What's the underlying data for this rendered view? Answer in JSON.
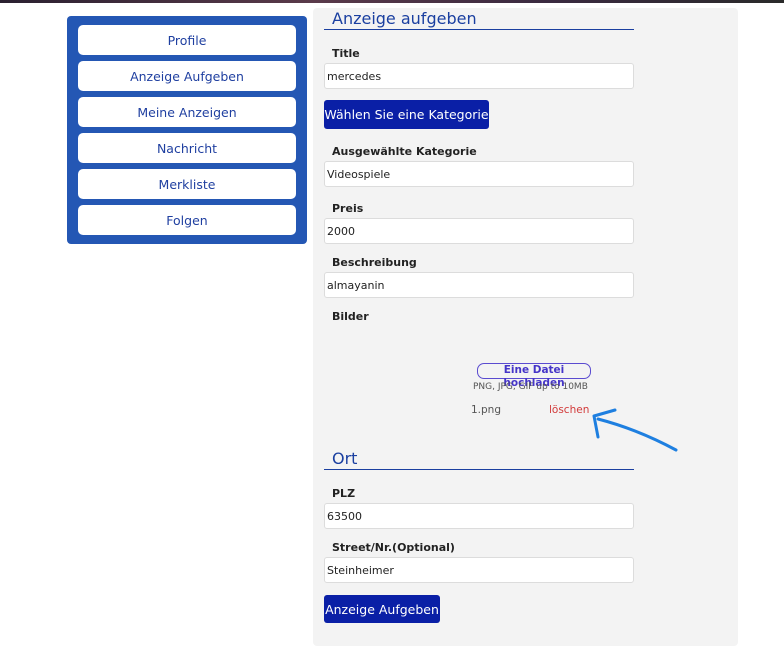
{
  "sidebar": {
    "items": [
      {
        "label": "Profile"
      },
      {
        "label": "Anzeige Aufgeben"
      },
      {
        "label": "Meine Anzeigen"
      },
      {
        "label": "Nachricht"
      },
      {
        "label": "Merkliste"
      },
      {
        "label": "Folgen"
      }
    ]
  },
  "form": {
    "heading": "Anzeige aufgeben",
    "title_label": "Title",
    "title_value": "mercedes",
    "category_button": "Wählen Sie eine Kategorie",
    "selected_category_label": "Ausgewählte Kategorie",
    "selected_category_value": "Videospiele",
    "price_label": "Preis",
    "price_value": "2000",
    "description_label": "Beschreibung",
    "description_value": "almayanin",
    "images_label": "Bilder",
    "upload_link": "Eine Datei hochladen",
    "upload_hint": "PNG, JPG, GIF up to 10MB",
    "file_name": "1.png",
    "delete_label": "löschen"
  },
  "location": {
    "heading": "Ort",
    "zip_label": "PLZ",
    "zip_value": "63500",
    "street_label": "Street/Nr.(Optional)",
    "street_value": "Steinheimer",
    "submit_button": "Anzeige Aufgeben"
  },
  "colors": {
    "sidebar_bg": "#2457b4",
    "primary_button": "#0a1fa6",
    "heading_text": "#1a3fa0",
    "delete_text": "#d23a3a",
    "annotation_arrow": "#1e7fe0"
  }
}
